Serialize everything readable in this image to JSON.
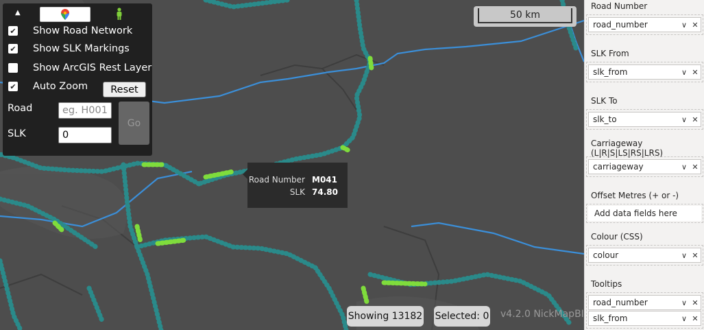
{
  "map_controls": {
    "collapse_icon": "triangle-up",
    "google_maps_icon": "google-maps-pin",
    "street_view_icon": "pegman",
    "options": [
      {
        "label": "Show Road Network",
        "checked": true
      },
      {
        "label": "Show SLK Markings",
        "checked": true
      },
      {
        "label": "Show ArcGIS Rest Layer",
        "checked": false
      },
      {
        "label": "Auto Zoom",
        "checked": true
      }
    ],
    "reset_label": "Reset",
    "road_label": "Road",
    "road_placeholder": "eg. H001",
    "slk_label": "SLK",
    "slk_value": "0",
    "go_label": "Go"
  },
  "scale_bar": {
    "label": "50 km"
  },
  "tooltip": {
    "rows": [
      {
        "key": "Road Number",
        "value": "M041"
      },
      {
        "key": "SLK",
        "value": "74.80"
      }
    ]
  },
  "status": {
    "showing": "Showing 13182",
    "selected": "Selected: 0",
    "version": "v4.2.0 NickMapBI"
  },
  "fields_pane": {
    "wells": [
      {
        "title": "Road Number",
        "fields": [
          "road_number"
        ]
      },
      {
        "title": "SLK From",
        "fields": [
          "slk_from"
        ]
      },
      {
        "title": "SLK To",
        "fields": [
          "slk_to"
        ]
      },
      {
        "title": "Carriageway (L|R|S|LS|RS|LRS)",
        "fields": [
          "carriageway"
        ]
      },
      {
        "title": "Offset Metres (+ or -)",
        "fields": [],
        "placeholder": "Add data fields here"
      },
      {
        "title": "Colour (CSS)",
        "fields": [
          "colour"
        ]
      },
      {
        "title": "Tooltips",
        "fields": [
          "road_number",
          "slk_from"
        ]
      }
    ]
  },
  "colors": {
    "map_bg": "#4d4d4d",
    "road_blue": "#3b8fd9",
    "slk_teal": "#2a8a8a",
    "slk_green": "#7fdc3c",
    "panel_bg": "#202020"
  }
}
